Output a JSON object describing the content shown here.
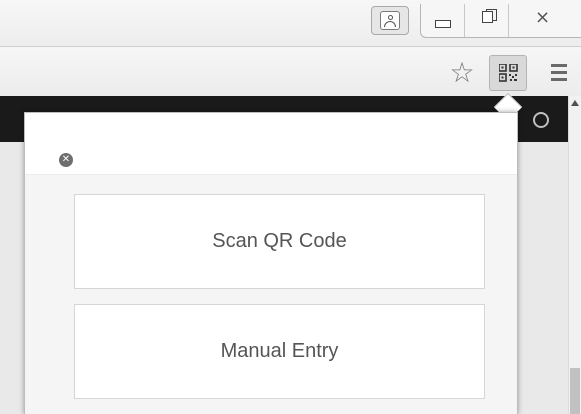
{
  "window": {
    "controls": {
      "profile_icon": "person-icon",
      "minimize_icon": "minimize-icon",
      "maximize_icon": "restore-icon",
      "close_glyph": "⨯"
    }
  },
  "toolbar": {
    "bookmark_glyph": "☆",
    "extension_icon": "qr-code-icon",
    "menu_icon": "hamburger-menu-icon"
  },
  "popup": {
    "close_glyph": "✕",
    "scan_label": "Scan QR Code",
    "manual_label": "Manual Entry"
  },
  "colors": {
    "popup_background": "#f5f5f5",
    "button_text": "#555555",
    "page_header": "#1a1a1a"
  }
}
